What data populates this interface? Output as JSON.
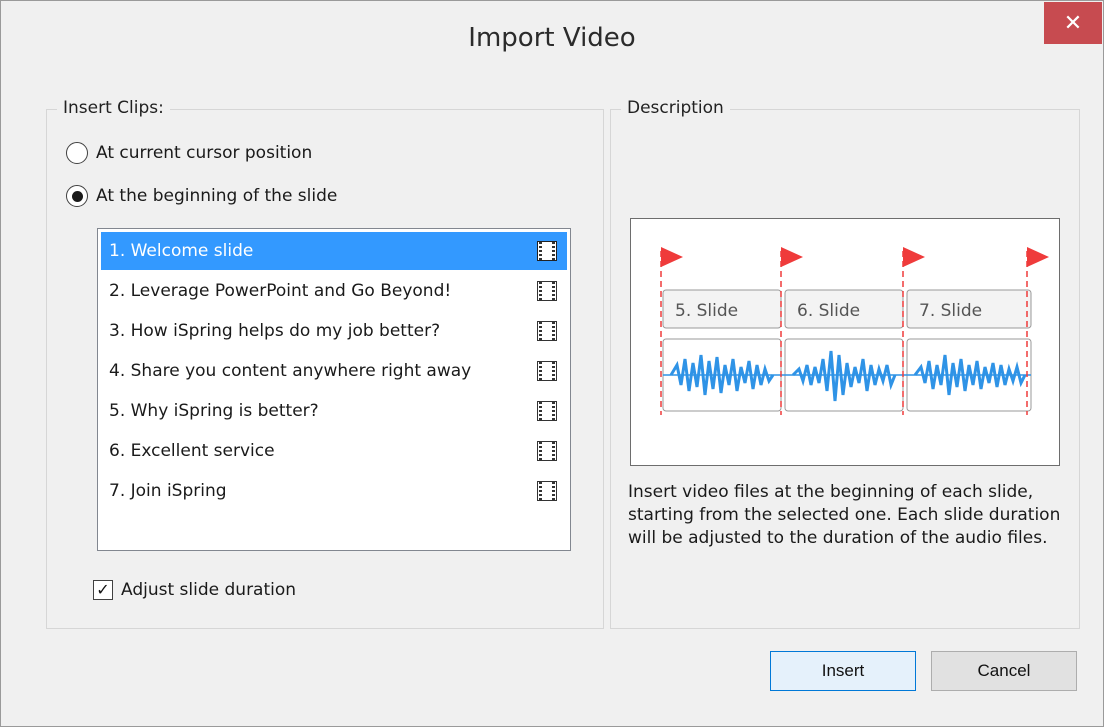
{
  "window": {
    "title": "Import Video",
    "close_glyph": "✕"
  },
  "insert_clips": {
    "title": "Insert Clips:",
    "options": [
      {
        "label": "At current cursor position",
        "selected": false
      },
      {
        "label": "At the beginning of the slide",
        "selected": true
      }
    ],
    "slides": [
      "1. Welcome slide",
      "2. Leverage PowerPoint and Go Beyond!",
      "3. How iSpring helps do my job better?",
      "4. Share you content anywhere right away",
      "5. Why iSpring is better?",
      "6. Excellent service",
      "7. Join iSpring"
    ],
    "selected_index": 0,
    "adjust_label": "Adjust slide duration",
    "adjust_checked": true
  },
  "description": {
    "title": "Description",
    "diagram_slides": [
      "5. Slide",
      "6. Slide",
      "7. Slide"
    ],
    "text": "Insert video files at the beginning of each slide, starting from the selected one. Each slide duration will be adjusted to the duration of the audio files."
  },
  "buttons": {
    "insert": "Insert",
    "cancel": "Cancel"
  },
  "colors": {
    "selection": "#3399ff",
    "close": "#c74b50",
    "marker": "#ef3b3b",
    "wave": "#2f93e6"
  }
}
